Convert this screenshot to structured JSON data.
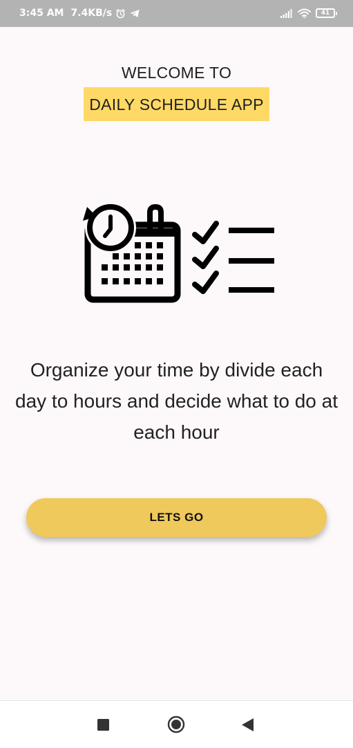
{
  "status_bar": {
    "time": "3:45 AM",
    "speed": "7.4KB/s",
    "battery": "41",
    "icons": [
      "alarm-icon",
      "telegram-icon",
      "signal-icon",
      "wifi-icon",
      "battery-icon"
    ]
  },
  "header": {
    "welcome": "WELCOME TO",
    "app_name": "DAILY SCHEDULE APP"
  },
  "logo_icon": "schedule-calendar-checklist-icon",
  "description": "Organize your time by divide each day to hours and decide what to do at each hour",
  "cta_button": {
    "label": "LETS GO"
  },
  "nav_bar": {
    "icons": [
      "recents-square-icon",
      "home-circle-icon",
      "back-triangle-icon"
    ]
  },
  "colors": {
    "status_bar": "#b3b3b3",
    "background": "#fdf9fb",
    "highlight": "#ffd966",
    "button": "#f0c95c",
    "text": "#222222"
  }
}
